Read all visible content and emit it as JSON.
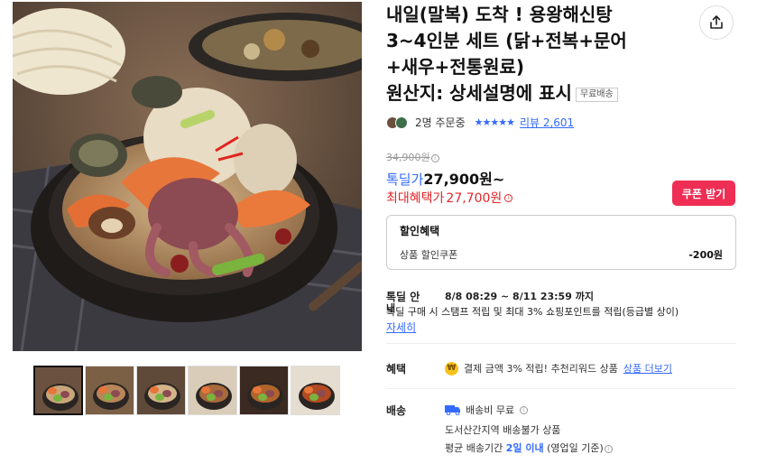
{
  "product": {
    "title_line1": "내일(말복) 도착 ! 용왕해신탕",
    "title_line2": "3~4인분 세트 (닭+전복+문어",
    "title_line3": "+새우+전통원료)",
    "title_line4": "원산지: 상세설명에 표시",
    "free_shipping_badge": "무료배송"
  },
  "meta": {
    "orders_text": "2명 주문중",
    "rating": 5,
    "stars": "★★★★★",
    "reviews_text": "리뷰 2,601"
  },
  "price": {
    "original": "34,900원",
    "sale_label": "톡딜가",
    "sale_price": "27,900원~",
    "max_label": "최대혜택가",
    "max_price": "27,700원",
    "coupon_button": "쿠폰 받기"
  },
  "discount": {
    "heading": "할인혜택",
    "item_label": "상품 할인쿠폰",
    "item_amount": "-200원"
  },
  "delivery": {
    "label_line1": "톡딜 안",
    "label_line2": "내",
    "date_range": "8/8 08:29 ~ 8/11 23:59 까지",
    "stamp_note": "톡딜 구매 시 스탬프 적립 및 최대 3% 쇼핑포인트를 적립(등급별 상이)",
    "detail_link": "자세히"
  },
  "benefit": {
    "label": "혜택",
    "icon_text": "₩",
    "text": "결제 금액 3% 적립! 추천리워드 상품",
    "link": "상품 더보기"
  },
  "shipping": {
    "label": "배송",
    "fee": "배송비 무료",
    "restriction": "도서산간지역 배송불가 상품",
    "avg_prefix": "평균 배송기간",
    "avg_value": "2일 이내",
    "avg_suffix": "(영업일 기준)"
  },
  "colors": {
    "accent_blue": "#346aff",
    "accent_red": "#e52528",
    "coupon_pink": "#ee2e54"
  },
  "thumbnails": [
    {
      "name": "thumb-1",
      "bg": "#6b5240",
      "soup": "#c9a67a"
    },
    {
      "name": "thumb-2",
      "bg": "#7c6046",
      "soup": "#b8865a"
    },
    {
      "name": "thumb-3",
      "bg": "#5f4a3a",
      "soup": "#d4b58a"
    },
    {
      "name": "thumb-4",
      "bg": "#d9cdb9",
      "soup": "#a86a3c"
    },
    {
      "name": "thumb-5",
      "bg": "#3a2a22",
      "soup": "#b0642c"
    },
    {
      "name": "thumb-6",
      "bg": "#e5ddd0",
      "soup": "#b24a22"
    }
  ]
}
